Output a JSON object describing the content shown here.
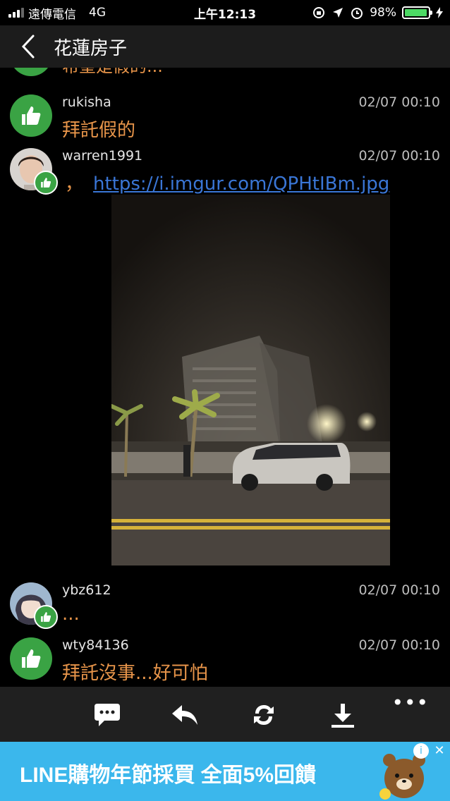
{
  "status_bar": {
    "carrier": "遠傳電信",
    "network": "4G",
    "time": "上午12:13",
    "battery": "98%",
    "battery_level": 0.98
  },
  "header": {
    "title": "花蓮房子"
  },
  "thread": {
    "partial_message": "希望是假的...",
    "posts": [
      {
        "username": "rukisha",
        "time": "02/07 00:10",
        "message": "拜託假的"
      },
      {
        "username": "warren1991",
        "time": "02/07 00:10",
        "prefix": "，",
        "link": "https://i.imgur.com/QPHtIBm.jpg"
      },
      {
        "username": "ybz612",
        "time": "02/07 00:10",
        "message": "..."
      },
      {
        "username": "wty84136",
        "time": "02/07 00:10",
        "message": "拜託沒事...好可怕"
      }
    ]
  },
  "toolbar": {
    "icons": [
      "comment-icon",
      "reply-icon",
      "refresh-icon",
      "download-icon",
      "more-icon"
    ],
    "more": "•••"
  },
  "ad": {
    "text": "LINE購物年節採買 全面5%回饋",
    "info": "i",
    "close": "✕"
  },
  "colors": {
    "accent_orange": "#e8954a",
    "link_blue": "#3a76d6",
    "like_green": "#3aa344",
    "ad_blue": "#3bb7ec"
  }
}
